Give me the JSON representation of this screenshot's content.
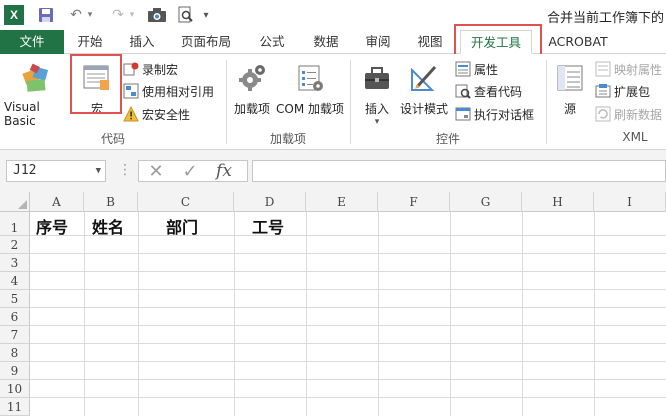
{
  "titlebar": {
    "title": "合并当前工作簿下的"
  },
  "qat": {
    "app_icon": "excel-icon",
    "save_icon": "save-icon",
    "undo_icon": "undo-icon",
    "redo_icon": "redo-icon",
    "extra_icon_1": "camera-icon",
    "extra_icon_2": "print-preview-icon",
    "customize": "▾"
  },
  "tabs": [
    {
      "label": "文件"
    },
    {
      "label": "开始"
    },
    {
      "label": "插入"
    },
    {
      "label": "页面布局"
    },
    {
      "label": "公式"
    },
    {
      "label": "数据"
    },
    {
      "label": "审阅"
    },
    {
      "label": "视图"
    },
    {
      "label": "开发工具"
    },
    {
      "label": "ACROBAT"
    }
  ],
  "ribbon": {
    "code": {
      "visual_basic": "Visual Basic",
      "macro": "宏",
      "record_macro": "录制宏",
      "relative_ref": "使用相对引用",
      "macro_security": "宏安全性",
      "group_label": "代码"
    },
    "addins": {
      "addin": "加载项",
      "com_addin": "COM 加载项",
      "group_label": "加载项"
    },
    "controls": {
      "insert": "插入",
      "design_mode": "设计模式",
      "properties": "属性",
      "view_code": "查看代码",
      "run_dialog": "执行对话框",
      "group_label": "控件"
    },
    "xml": {
      "source": "源",
      "map_properties": "映射属性",
      "expansion_packs": "扩展包",
      "refresh_data": "刷新数据",
      "group_label": "XML"
    }
  },
  "formula_bar": {
    "name_box": "J12",
    "formula": ""
  },
  "sheet": {
    "columns": [
      "A",
      "B",
      "C",
      "D",
      "E",
      "F",
      "G",
      "H",
      "I"
    ],
    "rows": [
      "1",
      "2",
      "3",
      "4",
      "5",
      "6",
      "7",
      "8",
      "9",
      "10",
      "11"
    ],
    "cells": {
      "A1": "序号",
      "B1": "姓名",
      "C1": "部门",
      "D1": "工号"
    }
  },
  "colors": {
    "excel_green": "#217346",
    "highlight_red": "#e0514f"
  }
}
